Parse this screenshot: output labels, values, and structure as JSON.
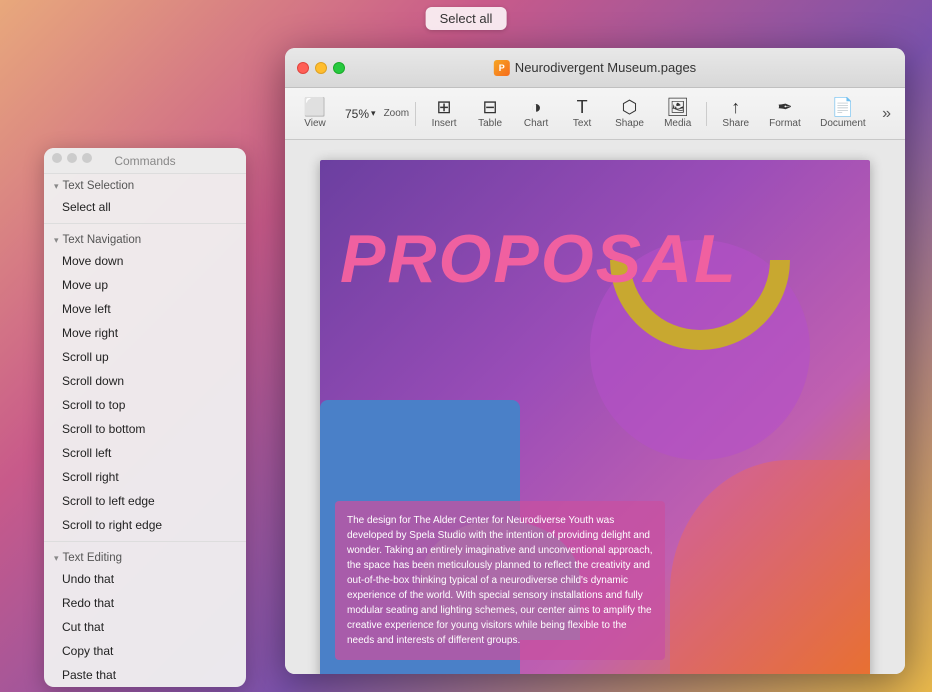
{
  "select_all_btn": "Select all",
  "commands_panel": {
    "title": "Commands",
    "sections": [
      {
        "name": "Text Selection",
        "items": [
          "Select all"
        ]
      },
      {
        "name": "Text Navigation",
        "items": [
          "Move down",
          "Move up",
          "Move left",
          "Move right",
          "Scroll up",
          "Scroll down",
          "Scroll to top",
          "Scroll to bottom",
          "Scroll left",
          "Scroll right",
          "Scroll to left edge",
          "Scroll to right edge"
        ]
      },
      {
        "name": "Text Editing",
        "items": [
          "Undo that",
          "Redo that",
          "Cut that",
          "Copy that",
          "Paste that"
        ]
      }
    ]
  },
  "pages_window": {
    "title": "Neurodivergent Museum.pages",
    "toolbar": {
      "view_label": "View",
      "zoom_value": "75%",
      "zoom_label": "Zoom",
      "insert_label": "Insert",
      "table_label": "Table",
      "chart_label": "Chart",
      "text_label": "Text",
      "shape_label": "Shape",
      "media_label": "Media",
      "share_label": "Share",
      "format_label": "Format",
      "document_label": "Document"
    },
    "document": {
      "proposal_text": "PROPOSAL",
      "body_text": "The design for The Alder Center for Neurodiverse Youth was developed by Spela Studio with the intention of providing delight and wonder. Taking an entirely imaginative and unconventional approach, the space has been meticulously planned to reflect the creativity and out-of-the-box thinking typical of a neurodiverse child's dynamic experience of the world. With special sensory installations and fully modular seating and lighting schemes, our center aims to amplify the creative experience for young visitors while being flexible to the needs and interests of different groups."
    }
  }
}
